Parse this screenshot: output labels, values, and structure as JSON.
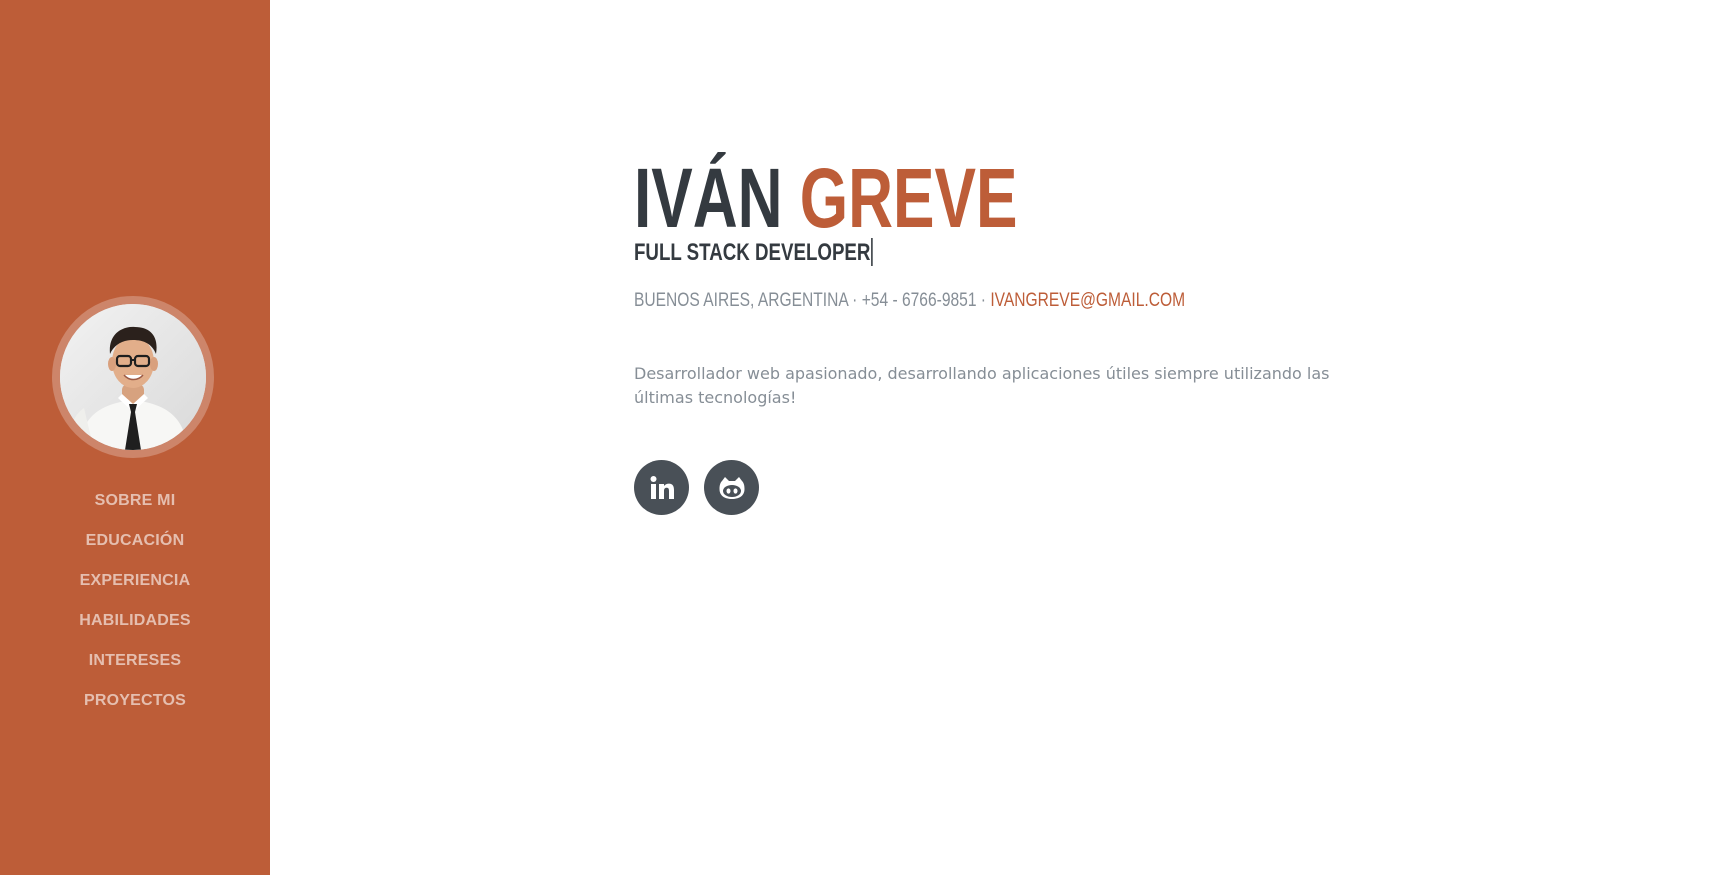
{
  "colors": {
    "primary": "#bd5d38",
    "dark": "#343a40",
    "muted": "#868e96",
    "icon_bg": "#495057"
  },
  "sidebar": {
    "avatar_alt": "profile-photo",
    "nav": [
      {
        "label": "SOBRE MI"
      },
      {
        "label": "EDUCACIÓN"
      },
      {
        "label": "EXPERIENCIA"
      },
      {
        "label": "HABILIDADES"
      },
      {
        "label": "INTERESES"
      },
      {
        "label": "PROYECTOS"
      }
    ]
  },
  "about": {
    "first_name": "IVÁN",
    "last_name": "GREVE",
    "subtitle": "FULL STACK DEVELOPER",
    "contact_prefix": "BUENOS AIRES, ARGENTINA · +54 - 6766-9851 ·",
    "email": "IVANGREVE@GMAIL.COM",
    "bio": "Desarrollador web apasionado, desarrollando aplicaciones útiles siempre utilizando las últimas tecnologías!",
    "social": [
      {
        "icon": "linkedin-icon"
      },
      {
        "icon": "github-icon"
      }
    ]
  }
}
